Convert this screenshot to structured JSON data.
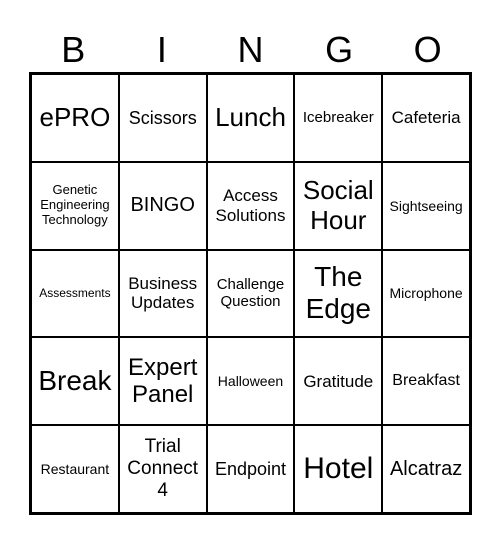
{
  "header": [
    "B",
    "I",
    "N",
    "G",
    "O"
  ],
  "cells": [
    "ePRO",
    "Scissors",
    "Lunch",
    "Icebreaker",
    "Cafeteria",
    "Genetic Engineering Technology",
    "BINGO",
    "Access Solutions",
    "Social Hour",
    "Sightseeing",
    "Assessments",
    "Business Updates",
    "Challenge Question",
    "The Edge",
    "Microphone",
    "Break",
    "Expert Panel",
    "Halloween",
    "Gratitude",
    "Breakfast",
    "Restaurant",
    "Trial Connect 4",
    "Endpoint",
    "Hotel",
    "Alcatraz"
  ]
}
